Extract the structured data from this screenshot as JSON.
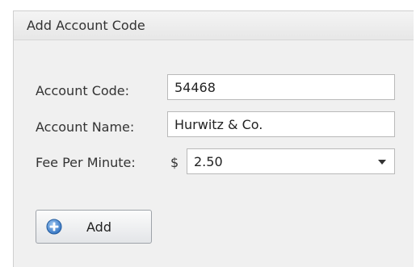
{
  "panel": {
    "title": "Add Account Code"
  },
  "form": {
    "account_code": {
      "label": "Account Code:",
      "value": "54468"
    },
    "account_name": {
      "label": "Account Name:",
      "value": "Hurwitz & Co."
    },
    "fee_per_minute": {
      "label": "Fee Per Minute:",
      "currency_symbol": "$",
      "value": "2.50"
    }
  },
  "buttons": {
    "add_label": "Add",
    "add_icon": "plus-circle-icon"
  },
  "colors": {
    "icon_blue": "#3a7fd0"
  }
}
